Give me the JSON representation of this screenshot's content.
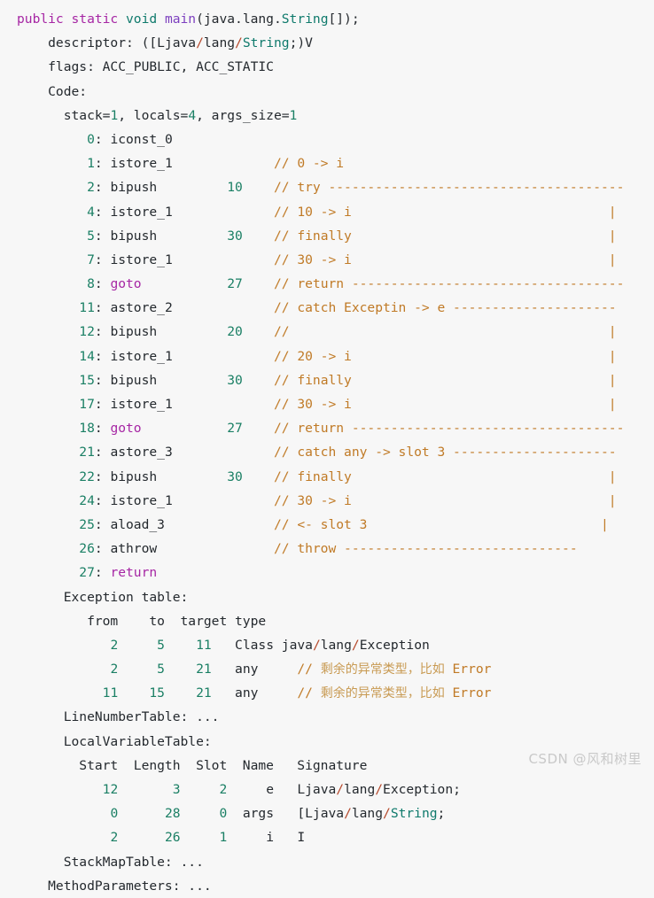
{
  "document": {
    "kind": "javap-bytecode-disassembly",
    "background_color": "#f7f7f7",
    "colors": {
      "plain": "#24292e",
      "keyword": "#a626a4",
      "type": "#0f7a6c",
      "method": "#7c3fbf",
      "number": "#1a7f64",
      "comment": "#c07a26",
      "slash": "#b5482a",
      "cjk_comment": "#c89a52",
      "watermark": "#c9c9c9"
    }
  },
  "lines": [
    {
      "id": "line-signature",
      "segments": [
        {
          "t": "public static ",
          "c": "keyword"
        },
        {
          "t": "void ",
          "c": "type"
        },
        {
          "t": "main",
          "c": "method"
        },
        {
          "t": "(java.lang.",
          "c": "plain"
        },
        {
          "t": "String",
          "c": "type"
        },
        {
          "t": "[]);",
          "c": "plain"
        }
      ]
    },
    {
      "id": "line-descriptor",
      "segments": [
        {
          "t": "    descriptor: ([Ljava",
          "c": "plain"
        },
        {
          "t": "/",
          "c": "slash"
        },
        {
          "t": "lang",
          "c": "plain"
        },
        {
          "t": "/",
          "c": "slash"
        },
        {
          "t": "String",
          "c": "type"
        },
        {
          "t": ";)V",
          "c": "plain"
        }
      ]
    },
    {
      "id": "line-flags",
      "segments": [
        {
          "t": "    flags: ACC_PUBLIC, ACC_STATIC",
          "c": "plain"
        }
      ]
    },
    {
      "id": "line-code-header",
      "segments": [
        {
          "t": "    Code:",
          "c": "plain"
        }
      ]
    },
    {
      "id": "line-stack-locals",
      "segments": [
        {
          "t": "      stack=",
          "c": "plain"
        },
        {
          "t": "1",
          "c": "num"
        },
        {
          "t": ", locals=",
          "c": "plain"
        },
        {
          "t": "4",
          "c": "num"
        },
        {
          "t": ", args_size=",
          "c": "plain"
        },
        {
          "t": "1",
          "c": "num"
        }
      ]
    },
    {
      "id": "line-instr-0",
      "segments": [
        {
          "t": "         ",
          "c": "plain"
        },
        {
          "t": "0",
          "c": "num"
        },
        {
          "t": ": iconst_0",
          "c": "plain"
        }
      ]
    },
    {
      "id": "line-instr-1",
      "segments": [
        {
          "t": "         ",
          "c": "plain"
        },
        {
          "t": "1",
          "c": "num"
        },
        {
          "t": ": istore_1",
          "c": "plain"
        },
        {
          "t": "             // 0 -> i",
          "c": "comment"
        }
      ]
    },
    {
      "id": "line-instr-2",
      "segments": [
        {
          "t": "         ",
          "c": "plain"
        },
        {
          "t": "2",
          "c": "num"
        },
        {
          "t": ": bipush         ",
          "c": "plain"
        },
        {
          "t": "10",
          "c": "num"
        },
        {
          "t": "    // try --------------------------------------",
          "c": "comment"
        }
      ]
    },
    {
      "id": "line-instr-4",
      "segments": [
        {
          "t": "         ",
          "c": "plain"
        },
        {
          "t": "4",
          "c": "num"
        },
        {
          "t": ": istore_1",
          "c": "plain"
        },
        {
          "t": "             // 10 -> i                                 |",
          "c": "comment"
        }
      ]
    },
    {
      "id": "line-instr-5",
      "segments": [
        {
          "t": "         ",
          "c": "plain"
        },
        {
          "t": "5",
          "c": "num"
        },
        {
          "t": ": bipush         ",
          "c": "plain"
        },
        {
          "t": "30",
          "c": "num"
        },
        {
          "t": "    // finally                                 |",
          "c": "comment"
        }
      ]
    },
    {
      "id": "line-instr-7",
      "segments": [
        {
          "t": "         ",
          "c": "plain"
        },
        {
          "t": "7",
          "c": "num"
        },
        {
          "t": ": istore_1",
          "c": "plain"
        },
        {
          "t": "             // 30 -> i                                 |",
          "c": "comment"
        }
      ]
    },
    {
      "id": "line-instr-8",
      "segments": [
        {
          "t": "         ",
          "c": "plain"
        },
        {
          "t": "8",
          "c": "num"
        },
        {
          "t": ": ",
          "c": "plain"
        },
        {
          "t": "goto",
          "c": "keyword"
        },
        {
          "t": "           ",
          "c": "plain"
        },
        {
          "t": "27",
          "c": "num"
        },
        {
          "t": "    // return -----------------------------------",
          "c": "comment"
        }
      ]
    },
    {
      "id": "line-instr-11",
      "segments": [
        {
          "t": "        ",
          "c": "plain"
        },
        {
          "t": "11",
          "c": "num"
        },
        {
          "t": ": astore_2",
          "c": "plain"
        },
        {
          "t": "             // catch Exceptin -> e ---------------------",
          "c": "comment"
        }
      ]
    },
    {
      "id": "line-instr-12",
      "segments": [
        {
          "t": "        ",
          "c": "plain"
        },
        {
          "t": "12",
          "c": "num"
        },
        {
          "t": ": bipush         ",
          "c": "plain"
        },
        {
          "t": "20",
          "c": "num"
        },
        {
          "t": "    //                                         |",
          "c": "comment"
        }
      ]
    },
    {
      "id": "line-instr-14",
      "segments": [
        {
          "t": "        ",
          "c": "plain"
        },
        {
          "t": "14",
          "c": "num"
        },
        {
          "t": ": istore_1",
          "c": "plain"
        },
        {
          "t": "             // 20 -> i                                 |",
          "c": "comment"
        }
      ]
    },
    {
      "id": "line-instr-15",
      "segments": [
        {
          "t": "        ",
          "c": "plain"
        },
        {
          "t": "15",
          "c": "num"
        },
        {
          "t": ": bipush         ",
          "c": "plain"
        },
        {
          "t": "30",
          "c": "num"
        },
        {
          "t": "    // finally                                 |",
          "c": "comment"
        }
      ]
    },
    {
      "id": "line-instr-17",
      "segments": [
        {
          "t": "        ",
          "c": "plain"
        },
        {
          "t": "17",
          "c": "num"
        },
        {
          "t": ": istore_1",
          "c": "plain"
        },
        {
          "t": "             // 30 -> i                                 |",
          "c": "comment"
        }
      ]
    },
    {
      "id": "line-instr-18",
      "segments": [
        {
          "t": "        ",
          "c": "plain"
        },
        {
          "t": "18",
          "c": "num"
        },
        {
          "t": ": ",
          "c": "plain"
        },
        {
          "t": "goto",
          "c": "keyword"
        },
        {
          "t": "           ",
          "c": "plain"
        },
        {
          "t": "27",
          "c": "num"
        },
        {
          "t": "    // return -----------------------------------",
          "c": "comment"
        }
      ]
    },
    {
      "id": "line-instr-21",
      "segments": [
        {
          "t": "        ",
          "c": "plain"
        },
        {
          "t": "21",
          "c": "num"
        },
        {
          "t": ": astore_3",
          "c": "plain"
        },
        {
          "t": "             // catch any -> slot 3 ---------------------",
          "c": "comment"
        }
      ]
    },
    {
      "id": "line-instr-22",
      "segments": [
        {
          "t": "        ",
          "c": "plain"
        },
        {
          "t": "22",
          "c": "num"
        },
        {
          "t": ": bipush         ",
          "c": "plain"
        },
        {
          "t": "30",
          "c": "num"
        },
        {
          "t": "    // finally                                 |",
          "c": "comment"
        }
      ]
    },
    {
      "id": "line-instr-24",
      "segments": [
        {
          "t": "        ",
          "c": "plain"
        },
        {
          "t": "24",
          "c": "num"
        },
        {
          "t": ": istore_1",
          "c": "plain"
        },
        {
          "t": "             // 30 -> i                                 |",
          "c": "comment"
        }
      ]
    },
    {
      "id": "line-instr-25",
      "segments": [
        {
          "t": "        ",
          "c": "plain"
        },
        {
          "t": "25",
          "c": "num"
        },
        {
          "t": ": aload_3",
          "c": "plain"
        },
        {
          "t": "              // <- slot 3                              |",
          "c": "comment"
        }
      ]
    },
    {
      "id": "line-instr-26",
      "segments": [
        {
          "t": "        ",
          "c": "plain"
        },
        {
          "t": "26",
          "c": "num"
        },
        {
          "t": ": athrow",
          "c": "plain"
        },
        {
          "t": "               // throw ------------------------------",
          "c": "comment"
        }
      ]
    },
    {
      "id": "line-instr-27",
      "segments": [
        {
          "t": "        ",
          "c": "plain"
        },
        {
          "t": "27",
          "c": "num"
        },
        {
          "t": ": ",
          "c": "plain"
        },
        {
          "t": "return",
          "c": "keyword"
        }
      ]
    },
    {
      "id": "line-exception-table-header",
      "segments": [
        {
          "t": "      Exception table:",
          "c": "plain"
        }
      ]
    },
    {
      "id": "line-exception-columns",
      "segments": [
        {
          "t": "         from    to  target type",
          "c": "plain"
        }
      ]
    },
    {
      "id": "line-exception-row-1",
      "segments": [
        {
          "t": "            ",
          "c": "plain"
        },
        {
          "t": "2",
          "c": "num"
        },
        {
          "t": "     ",
          "c": "plain"
        },
        {
          "t": "5",
          "c": "num"
        },
        {
          "t": "    ",
          "c": "plain"
        },
        {
          "t": "11",
          "c": "num"
        },
        {
          "t": "   Class java",
          "c": "plain"
        },
        {
          "t": "/",
          "c": "slash"
        },
        {
          "t": "lang",
          "c": "plain"
        },
        {
          "t": "/",
          "c": "slash"
        },
        {
          "t": "Exception",
          "c": "plain"
        }
      ]
    },
    {
      "id": "line-exception-row-2",
      "segments": [
        {
          "t": "            ",
          "c": "plain"
        },
        {
          "t": "2",
          "c": "num"
        },
        {
          "t": "     ",
          "c": "plain"
        },
        {
          "t": "5",
          "c": "num"
        },
        {
          "t": "    ",
          "c": "plain"
        },
        {
          "t": "21",
          "c": "num"
        },
        {
          "t": "   any   ",
          "c": "plain"
        },
        {
          "t": "  // ",
          "c": "comment"
        },
        {
          "t": "剩余的异常类型，比如",
          "c": "cjk"
        },
        {
          "t": " Error",
          "c": "comment"
        }
      ]
    },
    {
      "id": "line-exception-row-3",
      "segments": [
        {
          "t": "           ",
          "c": "plain"
        },
        {
          "t": "11",
          "c": "num"
        },
        {
          "t": "    ",
          "c": "plain"
        },
        {
          "t": "15",
          "c": "num"
        },
        {
          "t": "    ",
          "c": "plain"
        },
        {
          "t": "21",
          "c": "num"
        },
        {
          "t": "   any   ",
          "c": "plain"
        },
        {
          "t": "  // ",
          "c": "comment"
        },
        {
          "t": "剩余的异常类型，比如",
          "c": "cjk"
        },
        {
          "t": " Error",
          "c": "comment"
        }
      ]
    },
    {
      "id": "line-linenumbertable",
      "segments": [
        {
          "t": "      LineNumberTable: ...",
          "c": "plain"
        }
      ]
    },
    {
      "id": "line-localvariabletable",
      "segments": [
        {
          "t": "      LocalVariableTable:",
          "c": "plain"
        }
      ]
    },
    {
      "id": "line-localvar-columns",
      "segments": [
        {
          "t": "        Start  Length  Slot  Name   Signature",
          "c": "plain"
        }
      ]
    },
    {
      "id": "line-localvar-row-1",
      "segments": [
        {
          "t": "           ",
          "c": "plain"
        },
        {
          "t": "12",
          "c": "num"
        },
        {
          "t": "       ",
          "c": "plain"
        },
        {
          "t": "3",
          "c": "num"
        },
        {
          "t": "     ",
          "c": "plain"
        },
        {
          "t": "2",
          "c": "num"
        },
        {
          "t": "     e   Ljava",
          "c": "plain"
        },
        {
          "t": "/",
          "c": "slash"
        },
        {
          "t": "lang",
          "c": "plain"
        },
        {
          "t": "/",
          "c": "slash"
        },
        {
          "t": "Exception;",
          "c": "plain"
        }
      ]
    },
    {
      "id": "line-localvar-row-2",
      "segments": [
        {
          "t": "            ",
          "c": "plain"
        },
        {
          "t": "0",
          "c": "num"
        },
        {
          "t": "      ",
          "c": "plain"
        },
        {
          "t": "28",
          "c": "num"
        },
        {
          "t": "     ",
          "c": "plain"
        },
        {
          "t": "0",
          "c": "num"
        },
        {
          "t": "  args   [Ljava",
          "c": "plain"
        },
        {
          "t": "/",
          "c": "slash"
        },
        {
          "t": "lang",
          "c": "plain"
        },
        {
          "t": "/",
          "c": "slash"
        },
        {
          "t": "String",
          "c": "type"
        },
        {
          "t": ";",
          "c": "plain"
        }
      ]
    },
    {
      "id": "line-localvar-row-3",
      "segments": [
        {
          "t": "            ",
          "c": "plain"
        },
        {
          "t": "2",
          "c": "num"
        },
        {
          "t": "      ",
          "c": "plain"
        },
        {
          "t": "26",
          "c": "num"
        },
        {
          "t": "     ",
          "c": "plain"
        },
        {
          "t": "1",
          "c": "num"
        },
        {
          "t": "     i   I",
          "c": "plain"
        }
      ]
    },
    {
      "id": "line-stackmaptable",
      "segments": [
        {
          "t": "      StackMapTable: ...",
          "c": "plain"
        }
      ]
    },
    {
      "id": "line-methodparameters",
      "segments": [
        {
          "t": "    MethodParameters: ...",
          "c": "plain"
        }
      ]
    }
  ],
  "watermark": {
    "text": "CSDN @风和树里"
  }
}
